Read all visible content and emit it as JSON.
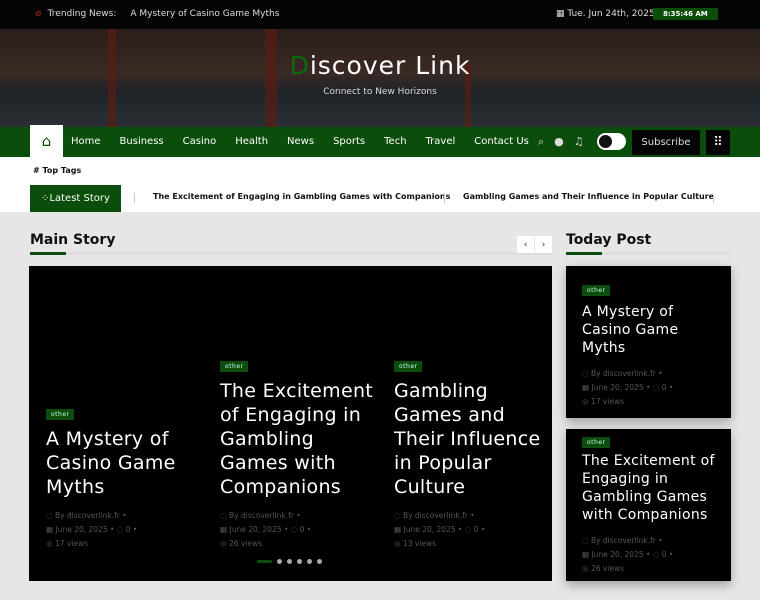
{
  "topbar": {
    "trending_label": "Trending News:",
    "trending_item": "A Mystery of Casino Game Myths",
    "date": "Tue. Jun 24th, 2025",
    "time": "8:35:46 AM"
  },
  "header": {
    "title_first": "D",
    "title_rest": "iscover Link",
    "tagline": "Connect to New Horizons"
  },
  "nav": {
    "items": [
      "Home",
      "Business",
      "Casino",
      "Health",
      "News",
      "Sports",
      "Tech",
      "Travel",
      "Contact Us"
    ],
    "subscribe": "Subscribe"
  },
  "tags": {
    "label": "# Top Tags"
  },
  "ticker": {
    "label": "Latest Story",
    "items": [
      "The Excitement of Engaging in Gambling Games with Companions",
      "Gambling Games and Their Influence in Popular Culture"
    ]
  },
  "main": {
    "title": "Main Story",
    "slides": [
      {
        "badge": "other",
        "title": "A Mystery of Casino Game Myths",
        "author": "By discoverlink.fr",
        "date": "June 20, 2025",
        "comments": "0",
        "views": "17 views"
      },
      {
        "badge": "other",
        "title": "The Excitement of Engaging in Gambling Games with Companions",
        "author": "By discoverlink.fr",
        "date": "June 20, 2025",
        "comments": "0",
        "views": "26 views"
      },
      {
        "badge": "other",
        "title": "Gambling Games and Their Influence in Popular Culture",
        "author": "By discoverlink.fr",
        "date": "June 20, 2025",
        "comments": "0",
        "views": "13 views"
      }
    ]
  },
  "today": {
    "title": "Today Post",
    "posts": [
      {
        "badge": "other",
        "title": "A Mystery of Casino Game Myths",
        "author": "By discoverlink.fr",
        "date": "June 20, 2025",
        "comments": "0",
        "views": "17 views"
      },
      {
        "badge": "other",
        "title": "The Excitement of Engaging in Gambling Games with Companions",
        "author": "By discoverlink.fr",
        "date": "June 20, 2025",
        "comments": "0",
        "views": "26 views"
      }
    ]
  },
  "colors": {
    "accent": "#0b4d0b",
    "topbar": "#050505"
  }
}
